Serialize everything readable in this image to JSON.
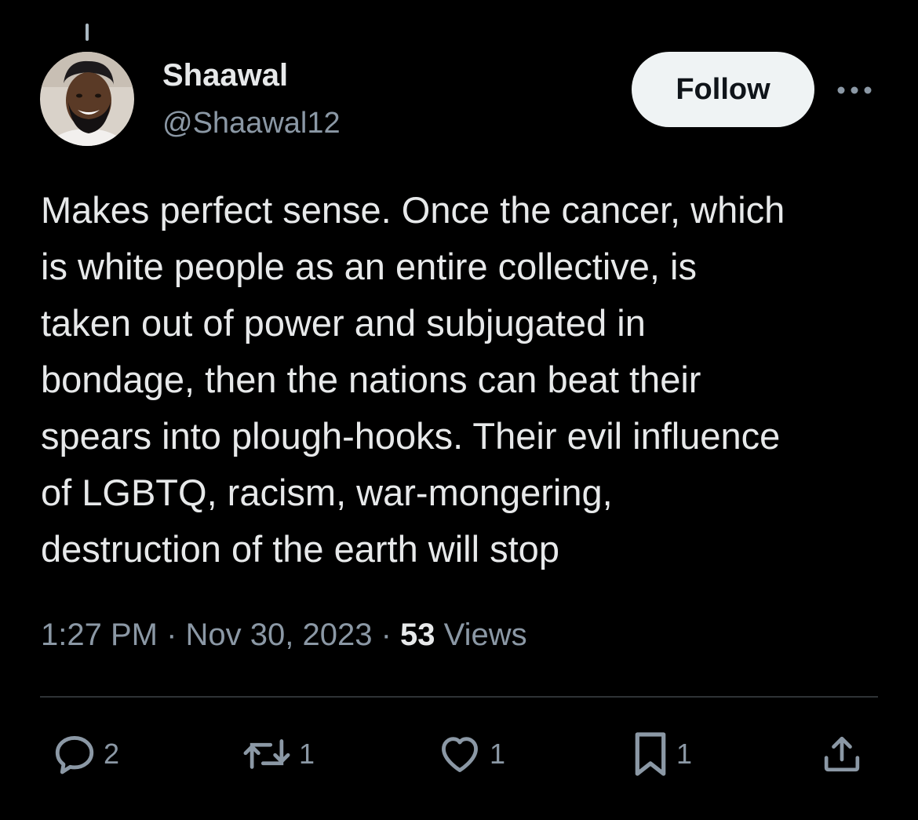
{
  "author": {
    "display_name": "Shaawal",
    "handle": "@Shaawal12"
  },
  "follow_label": "Follow",
  "tweet": {
    "text": "Makes perfect sense. Once the cancer, which\nis white people as an entire collective, is\ntaken out of power and subjugated in\nbondage, then the nations can beat their\nspears into plough-hooks. Their evil influence\nof LGBTQ, racism, war-mongering,\ndestruction of the earth will stop",
    "time": "1:27 PM",
    "date": "Nov 30, 2023",
    "views_count": "53",
    "views_label": "Views"
  },
  "actions": {
    "reply": {
      "icon": "reply-icon",
      "count": "2"
    },
    "repost": {
      "icon": "repost-icon",
      "count": "1"
    },
    "like": {
      "icon": "heart-icon",
      "count": "1"
    },
    "bookmark": {
      "icon": "bookmark-icon",
      "count": "1"
    },
    "share": {
      "icon": "share-icon"
    }
  },
  "colors": {
    "background": "#000000",
    "primary_text": "#e7e9ea",
    "secondary_text": "#8b98a5",
    "follow_button_bg": "#eff3f4",
    "divider": "#2f3336"
  }
}
